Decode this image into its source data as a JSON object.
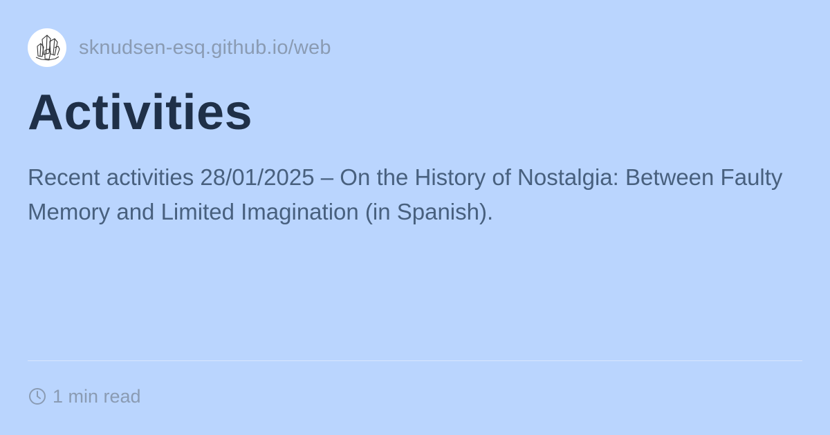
{
  "site": {
    "logo_icon": "crystal-cluster-logo-icon",
    "name": "sknudsen-esq.github.io/web"
  },
  "page": {
    "title": "Activities",
    "description": "Recent activities 28/01/2025 – On the History of Nostalgia: Between Faulty Memory and Limited Imagination (in Spanish)."
  },
  "meta": {
    "clock_icon": "clock-icon",
    "read_time": "1 min read"
  },
  "colors": {
    "background": "#bad5fe",
    "title": "#1f3048",
    "description": "#48607e",
    "muted": "#8a9bb3",
    "divider": "#d8e6fc"
  }
}
